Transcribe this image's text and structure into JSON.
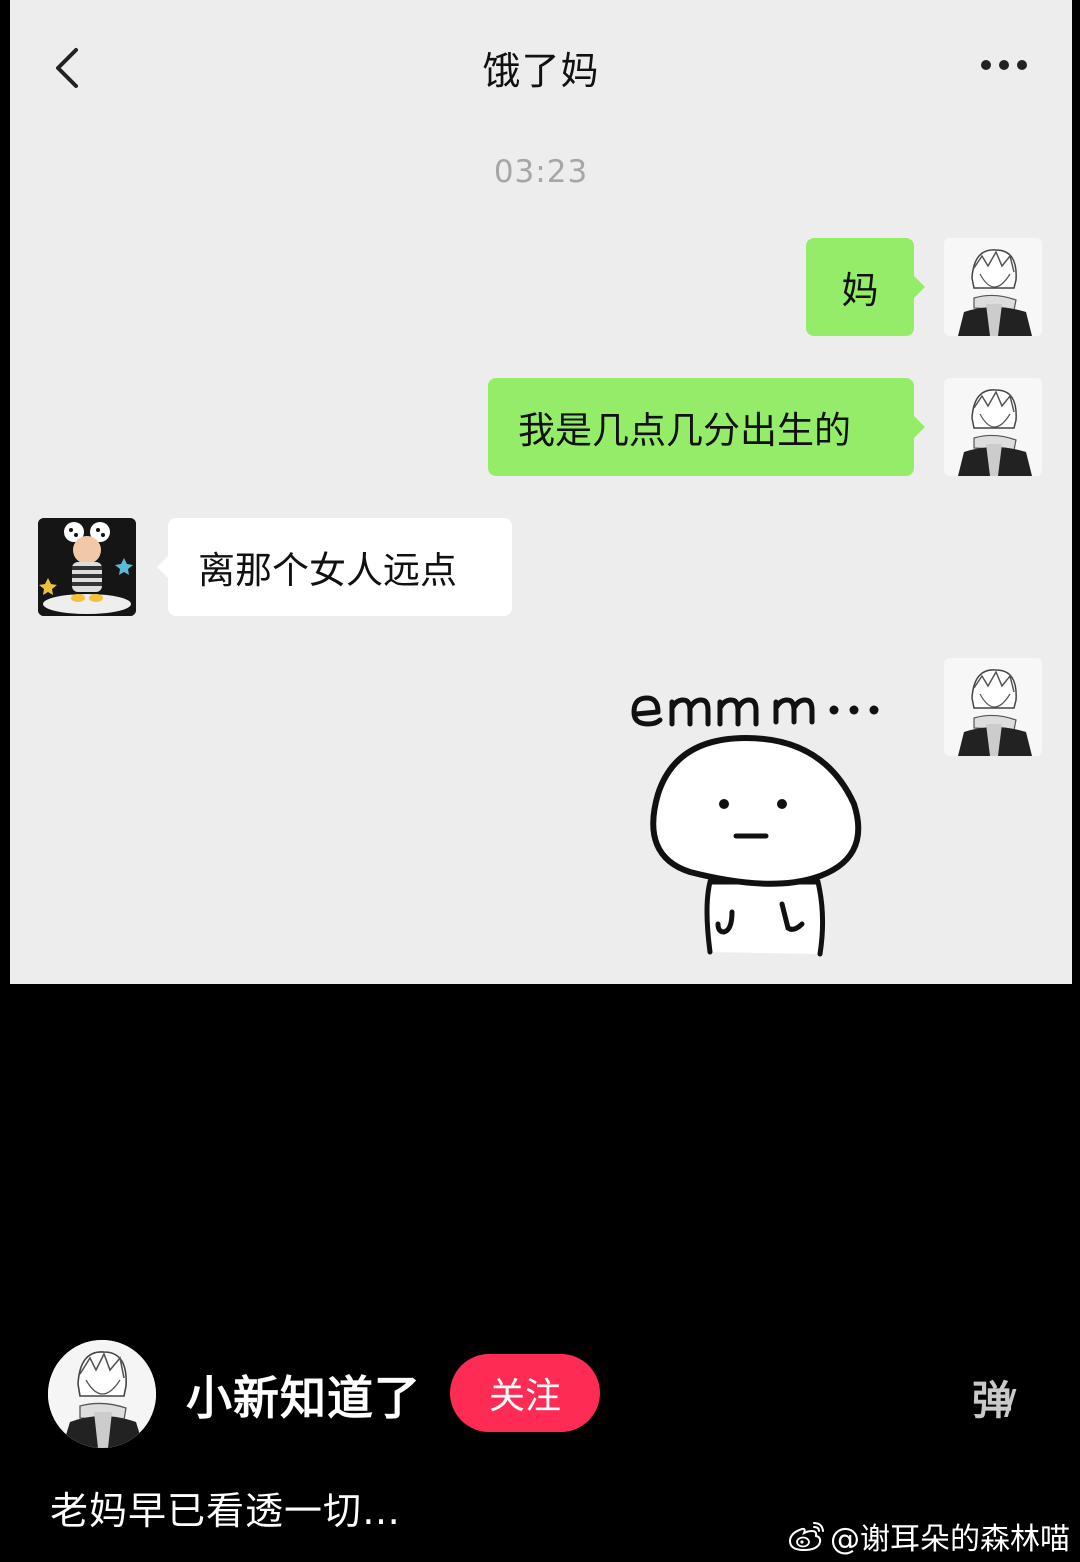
{
  "chat": {
    "title": "饿了妈",
    "timestamp": "03:23",
    "messages": [
      {
        "side": "right",
        "text": "妈"
      },
      {
        "side": "right",
        "text": "我是几点几分出生的"
      },
      {
        "side": "left",
        "text": "离那个女人远点"
      },
      {
        "side": "right",
        "sticker_text": "emmm..."
      }
    ],
    "colors": {
      "sent_bubble": "#95ec69",
      "received_bubble": "#ffffff",
      "background": "#ededed"
    }
  },
  "video": {
    "author_name": "小新知道了",
    "follow_label": "关注",
    "danmaku_label": "弹",
    "caption": "老妈早已看透一切…",
    "accent": "#fe2c55"
  },
  "watermark": {
    "text": "@谢耳朵的森林喵",
    "icon": "weibo-icon"
  }
}
